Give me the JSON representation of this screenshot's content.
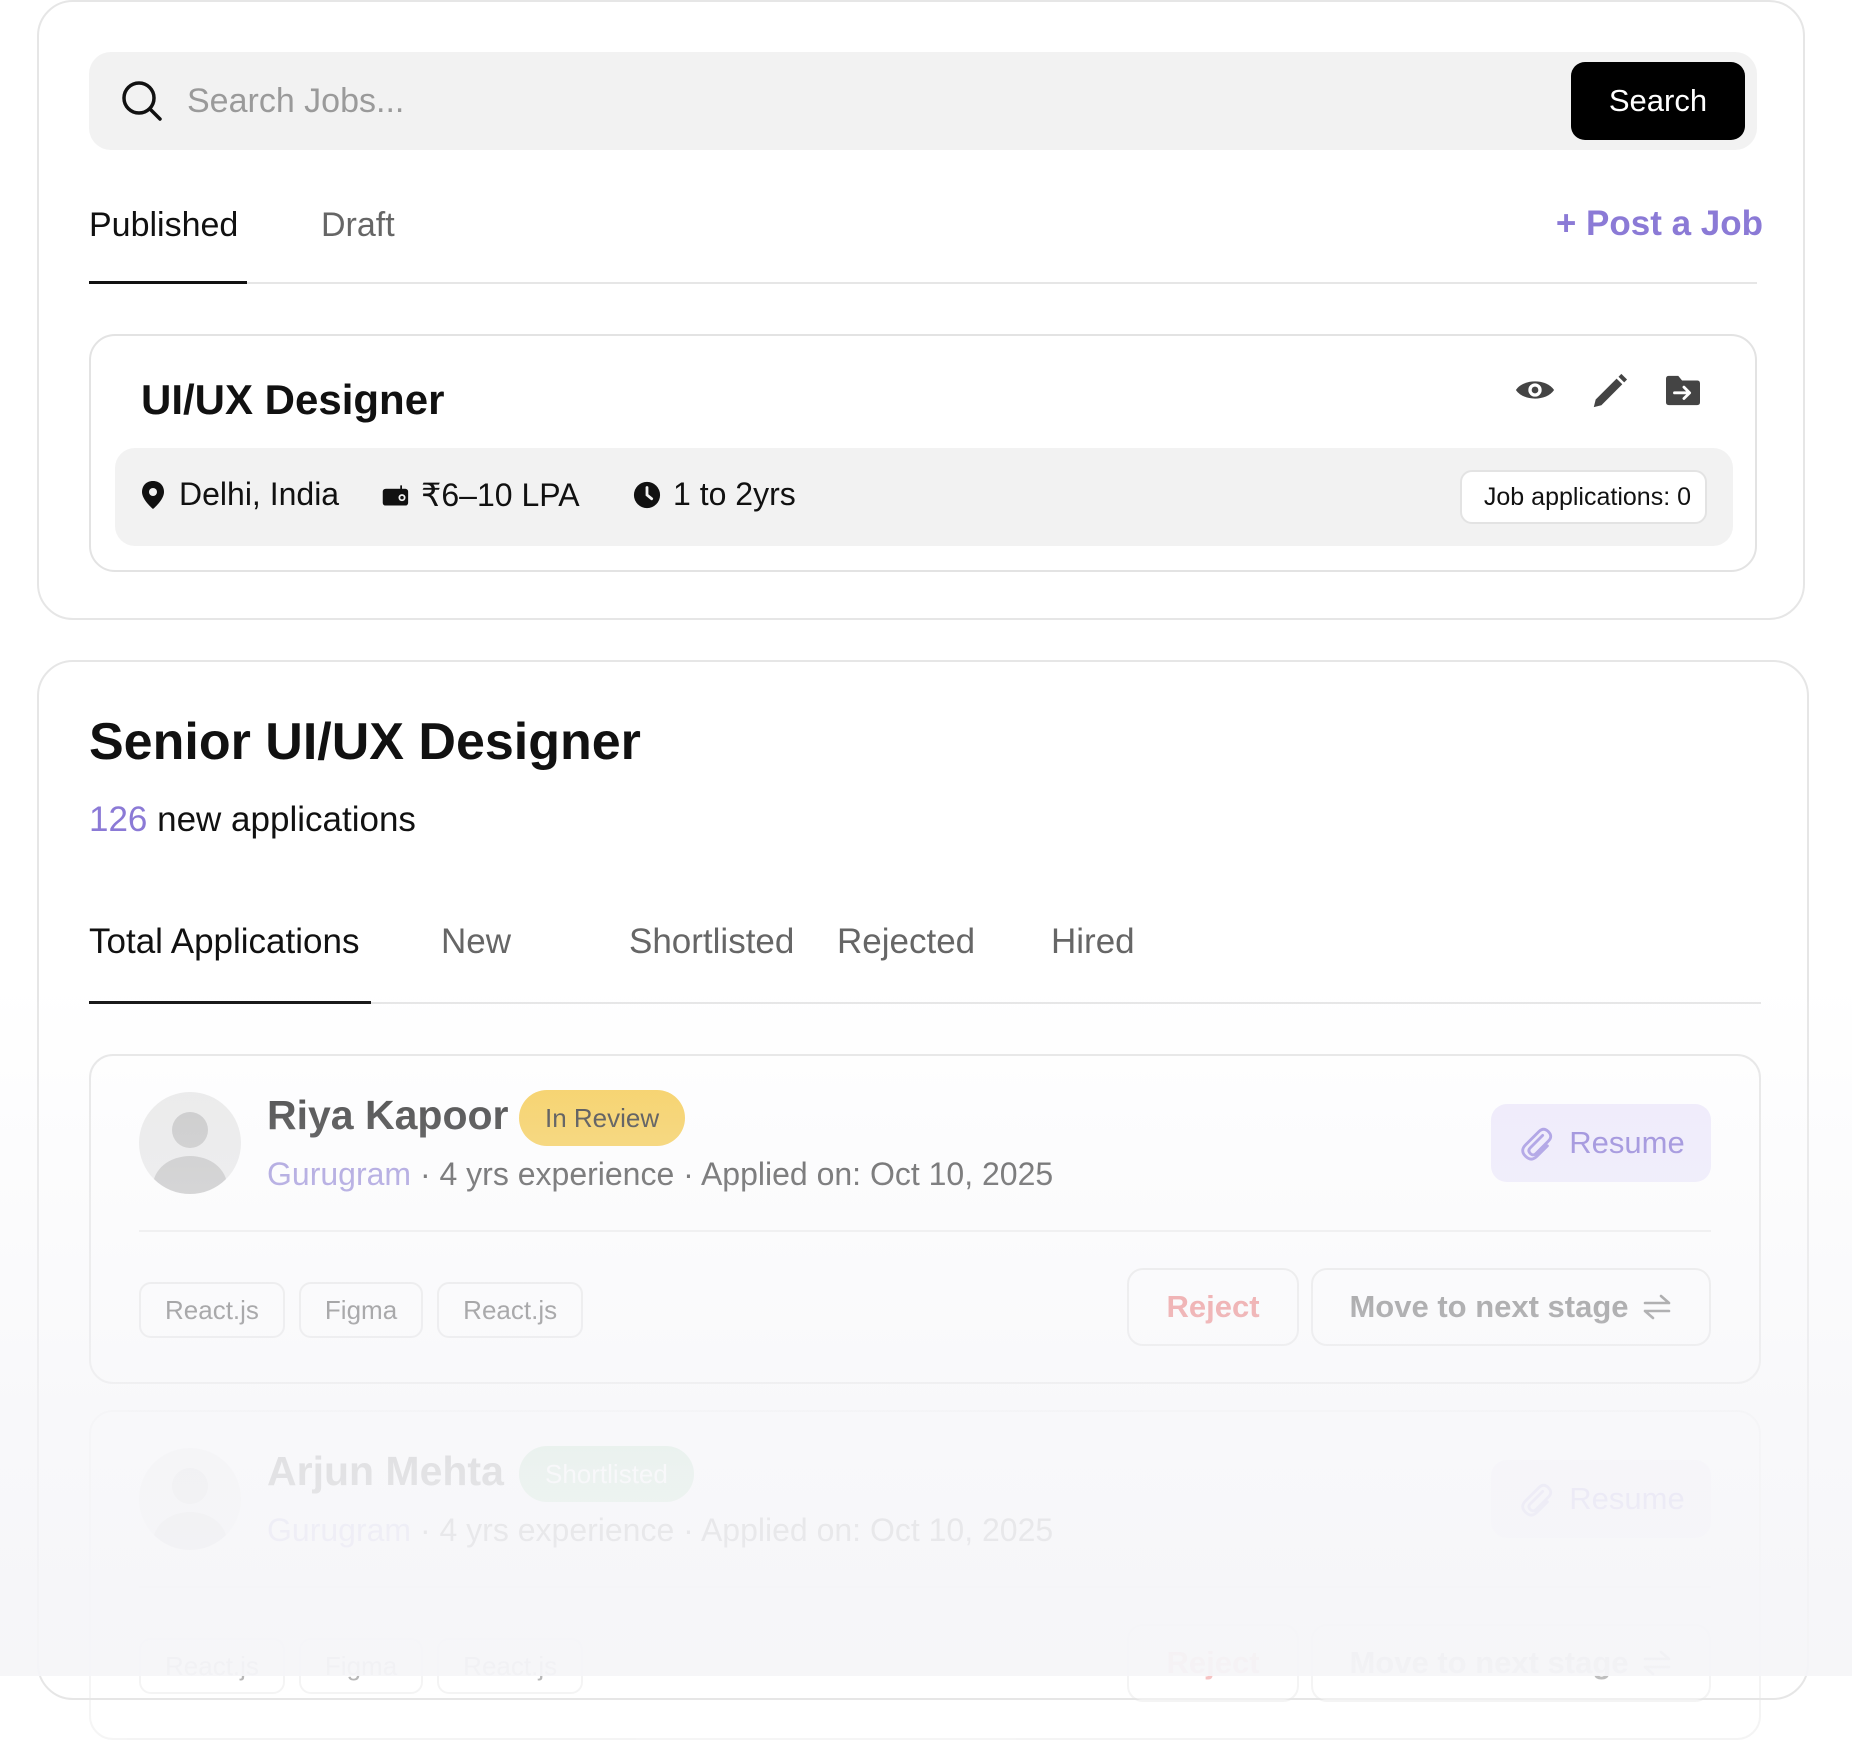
{
  "search": {
    "placeholder": "Search Jobs...",
    "button_label": "Search"
  },
  "job_tabs": [
    {
      "label": "Published",
      "active": true
    },
    {
      "label": "Draft",
      "active": false
    }
  ],
  "post_job_label": "+ Post a Job",
  "job": {
    "title": "UI/UX Designer",
    "location": "Delhi, India",
    "salary": "₹6–10 LPA",
    "experience": "1 to 2yrs",
    "applications": "Job applications: 0",
    "actions": [
      "eye-icon",
      "pencil-icon",
      "move-folder-icon"
    ]
  },
  "detail": {
    "title": "Senior UI/UX Designer",
    "new_count": "126",
    "new_label": " new applications",
    "tabs": [
      {
        "label": "Total Applications",
        "active": true
      },
      {
        "label": "New",
        "active": false
      },
      {
        "label": "Shortlisted",
        "active": false
      },
      {
        "label": "Rejected",
        "active": false
      },
      {
        "label": "Hired",
        "active": false
      }
    ]
  },
  "applicants": [
    {
      "name": "Riya Kapoor",
      "status": "In Review",
      "status_bg": "#f7cd55",
      "status_color": "#3a3a3a",
      "city": "Gurugram",
      "details": " · 4 yrs experience · Applied on: Oct 10, 2025",
      "resume_label": "Resume",
      "skills": [
        "React.js",
        "Figma",
        "React.js"
      ],
      "reject_label": "Reject",
      "next_label": "Move to next stage"
    },
    {
      "name": "Arjun Mehta",
      "status": "Shortlisted",
      "status_bg": "#8fd19e",
      "status_color": "#ffffff",
      "city": "Gurugram",
      "details": " · 4 yrs experience · Applied on: Oct 10, 2025",
      "resume_label": "Resume",
      "skills": [
        "React.js",
        "Figma",
        "React.js"
      ],
      "reject_label": "Reject",
      "next_label": "Move to next stage"
    }
  ],
  "colors": {
    "accent": "#8b7ad6",
    "reject": "#ea7272",
    "surface": "#f2f2f2"
  }
}
